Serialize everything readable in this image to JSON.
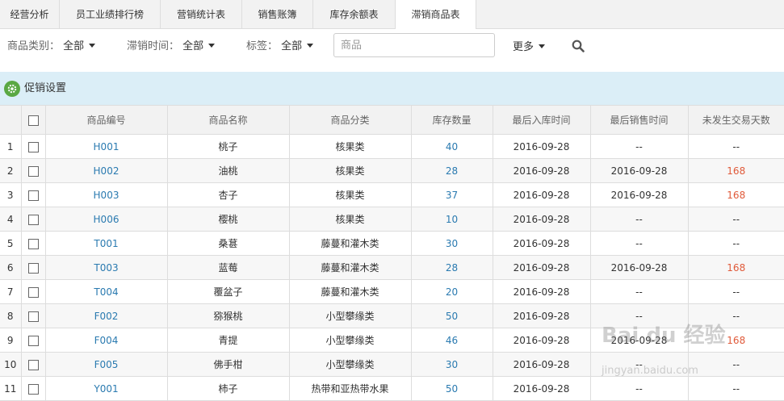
{
  "tabs": [
    {
      "label": "经营分析"
    },
    {
      "label": "员工业绩排行榜"
    },
    {
      "label": "营销统计表"
    },
    {
      "label": "销售账簿"
    },
    {
      "label": "库存余额表"
    },
    {
      "label": "滞销商品表",
      "active": true
    }
  ],
  "filters": {
    "category_label": "商品类别：",
    "category_value": "全部",
    "time_label": "滞销时间：",
    "time_value": "全部",
    "tag_label": "标签：",
    "tag_value": "全部",
    "search_placeholder": "商品",
    "more_label": "更多"
  },
  "promo": {
    "label": "促销设置"
  },
  "table": {
    "headers": [
      "商品编号",
      "商品名称",
      "商品分类",
      "库存数量",
      "最后入库时间",
      "最后销售时间",
      "未发生交易天数"
    ],
    "rows": [
      {
        "idx": "1",
        "code": "H001",
        "name": "桃子",
        "category": "核果类",
        "qty": "40",
        "in_date": "2016-09-28",
        "sale_date": "--",
        "days": "--"
      },
      {
        "idx": "2",
        "code": "H002",
        "name": "油桃",
        "category": "核果类",
        "qty": "28",
        "in_date": "2016-09-28",
        "sale_date": "2016-09-28",
        "days": "168"
      },
      {
        "idx": "3",
        "code": "H003",
        "name": "杏子",
        "category": "核果类",
        "qty": "37",
        "in_date": "2016-09-28",
        "sale_date": "2016-09-28",
        "days": "168"
      },
      {
        "idx": "4",
        "code": "H006",
        "name": "樱桃",
        "category": "核果类",
        "qty": "10",
        "in_date": "2016-09-28",
        "sale_date": "--",
        "days": "--"
      },
      {
        "idx": "5",
        "code": "T001",
        "name": "桑葚",
        "category": "藤蔓和灌木类",
        "qty": "30",
        "in_date": "2016-09-28",
        "sale_date": "--",
        "days": "--"
      },
      {
        "idx": "6",
        "code": "T003",
        "name": "蓝莓",
        "category": "藤蔓和灌木类",
        "qty": "28",
        "in_date": "2016-09-28",
        "sale_date": "2016-09-28",
        "days": "168"
      },
      {
        "idx": "7",
        "code": "T004",
        "name": "覆盆子",
        "category": "藤蔓和灌木类",
        "qty": "20",
        "in_date": "2016-09-28",
        "sale_date": "--",
        "days": "--"
      },
      {
        "idx": "8",
        "code": "F002",
        "name": "猕猴桃",
        "category": "小型攀缘类",
        "qty": "50",
        "in_date": "2016-09-28",
        "sale_date": "--",
        "days": "--"
      },
      {
        "idx": "9",
        "code": "F004",
        "name": "青提",
        "category": "小型攀缘类",
        "qty": "46",
        "in_date": "2016-09-28",
        "sale_date": "2016-09-28",
        "days": "168"
      },
      {
        "idx": "10",
        "code": "F005",
        "name": "佛手柑",
        "category": "小型攀缘类",
        "qty": "30",
        "in_date": "2016-09-28",
        "sale_date": "--",
        "days": "--"
      },
      {
        "idx": "11",
        "code": "Y001",
        "name": "柿子",
        "category": "热带和亚热带水果",
        "qty": "50",
        "in_date": "2016-09-28",
        "sale_date": "--",
        "days": "--"
      }
    ]
  },
  "watermark": {
    "main": "Bai du 经验",
    "sub": "jingyan.baidu.com"
  },
  "colors": {
    "link": "#2a7ab0",
    "alert": "#e05a3a",
    "promo_bg": "#dbeef7",
    "gear": "#5aa843"
  }
}
